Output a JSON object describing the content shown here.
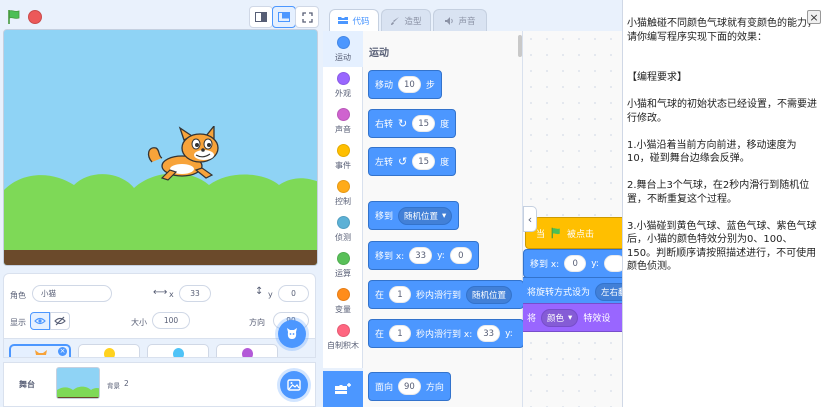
{
  "controls": {
    "green_flag_icon": "green-flag-icon",
    "stop_icon": "stop-sign-icon",
    "stage_modes": [
      "small-stage-icon",
      "normal-stage-icon",
      "fullscreen-icon"
    ]
  },
  "sprite_info": {
    "sprite_label": "角色",
    "sprite_name": "小猫",
    "x_label": "x",
    "x_value": "33",
    "y_label": "y",
    "y_value": "0",
    "show_label": "显示",
    "size_label": "大小",
    "size_value": "100",
    "direction_label": "方向",
    "direction_value": "90"
  },
  "sprite_thumbs": [
    "cat",
    "yellow-balloon",
    "blue-balloon",
    "purple-balloon"
  ],
  "stage_panel": {
    "label": "舞台",
    "backdrop_label": "背景",
    "backdrop_count": "2"
  },
  "tabs": [
    {
      "label": "代码",
      "icon": "code-icon"
    },
    {
      "label": "造型",
      "icon": "brush-icon"
    },
    {
      "label": "声音",
      "icon": "speaker-icon"
    }
  ],
  "categories": [
    {
      "label": "运动",
      "color": "#4c97ff"
    },
    {
      "label": "外观",
      "color": "#9966ff"
    },
    {
      "label": "声音",
      "color": "#cf63cf"
    },
    {
      "label": "事件",
      "color": "#ffbf00"
    },
    {
      "label": "控制",
      "color": "#ffab19"
    },
    {
      "label": "侦测",
      "color": "#5cb1d6"
    },
    {
      "label": "运算",
      "color": "#59c059"
    },
    {
      "label": "变量",
      "color": "#ff8c1a"
    },
    {
      "label": "自制积木",
      "color": "#ff6680"
    }
  ],
  "palette": {
    "title": "运动",
    "blocks": {
      "move": {
        "pre": "移动",
        "value": "10",
        "post": "步"
      },
      "turn_right": {
        "pre": "右转",
        "value": "15",
        "post": "度"
      },
      "turn_left": {
        "pre": "左转",
        "value": "15",
        "post": "度"
      },
      "goto": {
        "pre": "移到",
        "menu": "随机位置"
      },
      "goto_xy": {
        "pre": "移到 x:",
        "x": "33",
        "ylabel": "y:",
        "y": "0"
      },
      "glide": {
        "pre": "在",
        "value": "1",
        "mid": "秒内滑行到",
        "menu": "随机位置"
      },
      "glide_xy": {
        "pre": "在",
        "value": "1",
        "mid": "秒内滑行到 x:",
        "x": "33",
        "ylabel": "y:"
      },
      "point": {
        "pre": "面向",
        "value": "90",
        "post": "方向"
      }
    }
  },
  "script": {
    "hat": "当",
    "hat_post": "被点击",
    "goto_pre": "移到 x:",
    "goto_x": "0",
    "goto_ylabel": "y:",
    "rotation_pre": "将旋转方式设为",
    "rotation_value": "左右翻",
    "effect_pre": "将",
    "effect_menu": "颜色",
    "effect_post": "特效设"
  },
  "instructions": {
    "text": "小猫触碰不同颜色气球就有变颜色的能力，请你编写程序实现下面的效果：\n\n\n【编程要求】\n\n小猫和气球的初始状态已经设置，不需要进行修改。\n\n1.小猫沿着当前方向前进，移动速度为10，碰到舞台边缘会反弹。\n\n2.舞台上3个气球，在2秒内滑行到随机位置，不断重复这个过程。\n\n3.小猫碰到黄色气球、蓝色气球、紫色气球后，小猫的颜色特效分别为0、100、150。判断顺序请按照描述进行，不可使用颜色侦测。",
    "close_label": "×"
  }
}
